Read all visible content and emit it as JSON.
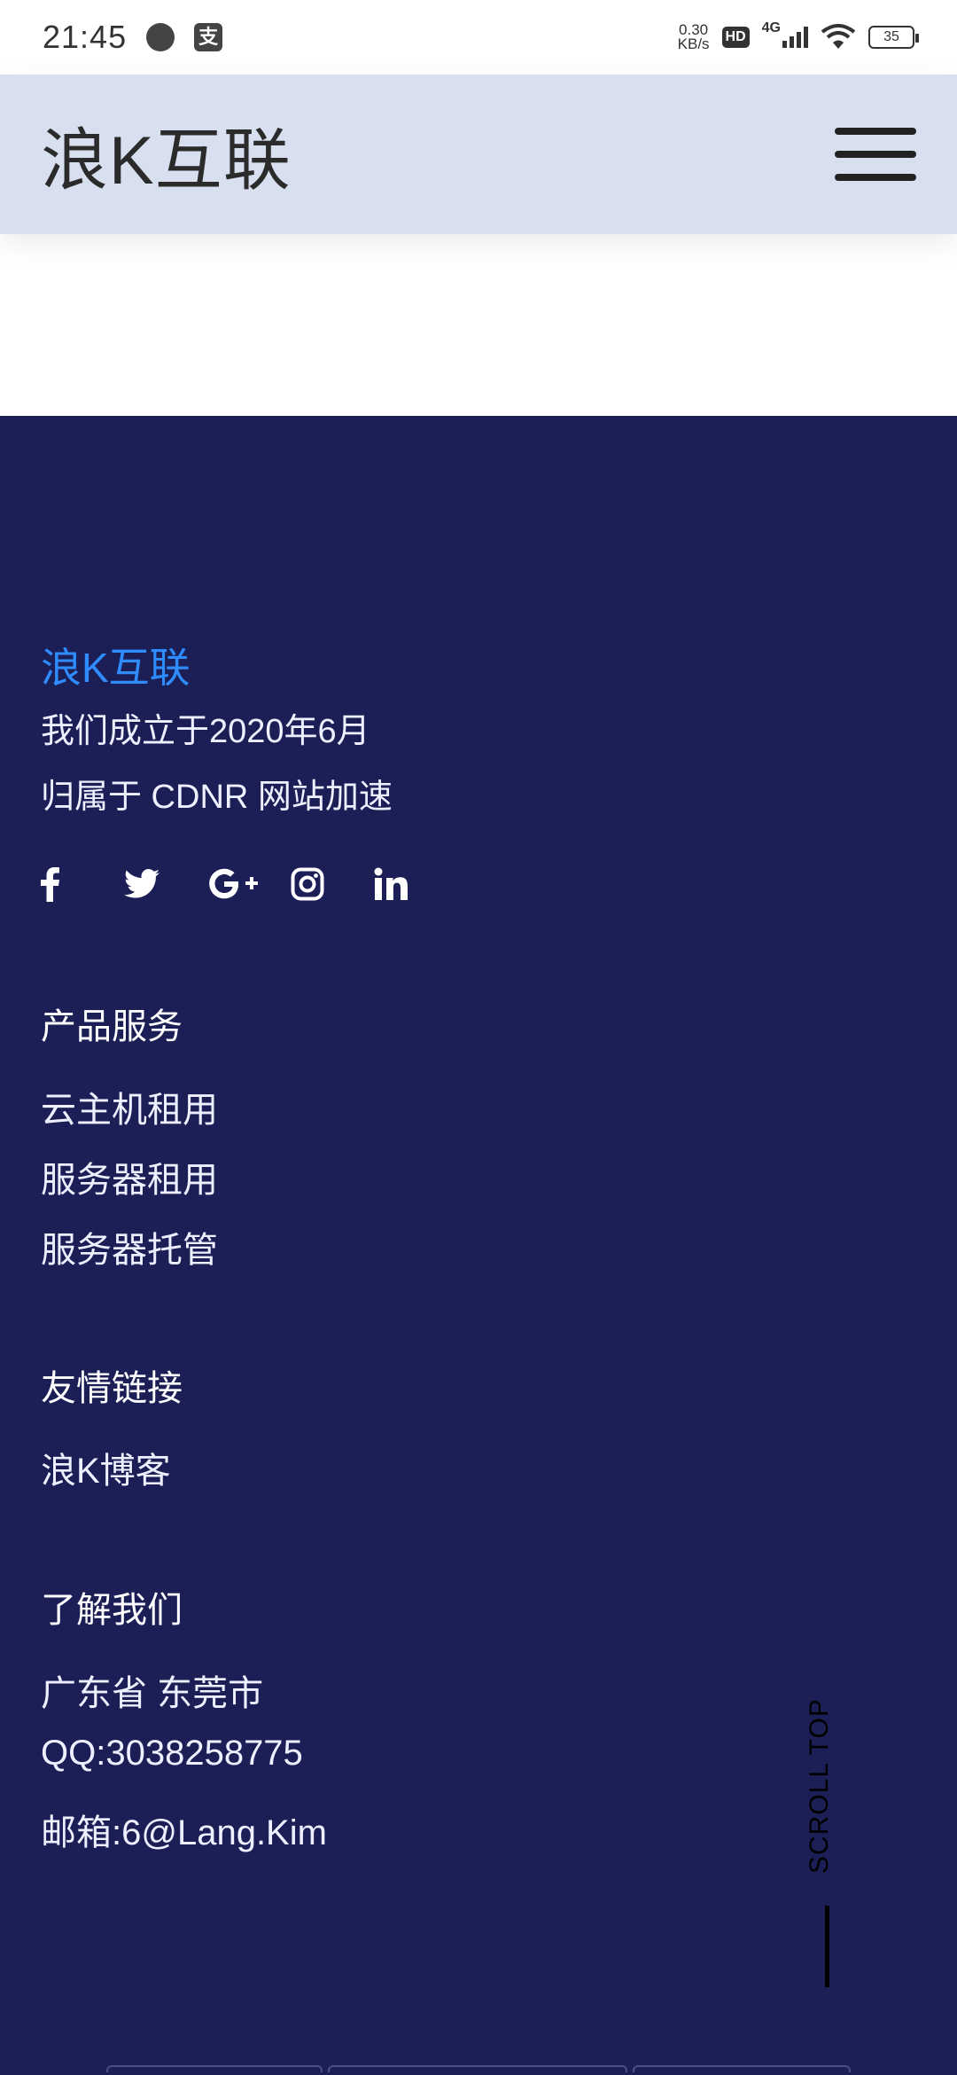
{
  "status_bar": {
    "time": "21:45",
    "pay_glyph": "支",
    "speed_value": "0.30",
    "speed_unit": "KB/s",
    "hd": "HD",
    "network": "4G",
    "battery": "35"
  },
  "navbar": {
    "brand": "浪K互联",
    "menu_icon": "hamburger-menu-icon"
  },
  "footer": {
    "about": {
      "title": "浪K互联",
      "line1": "我们成立于2020年6月",
      "line2": "归属于 CDNR 网站加速"
    },
    "social_icons": [
      "facebook-icon",
      "twitter-icon",
      "google-plus-icon",
      "instagram-icon",
      "linkedin-icon"
    ],
    "products": {
      "heading": "产品服务",
      "links": [
        "云主机租用",
        "服务器租用",
        "服务器托管"
      ]
    },
    "friends": {
      "heading": "友情链接",
      "links": [
        "浪K博客"
      ]
    },
    "contact": {
      "heading": "了解我们",
      "items": [
        "广东省 东莞市",
        "QQ:3038258775",
        "邮箱:6@Lang.Kim"
      ]
    },
    "scroll_top": "SCROLL TOP"
  },
  "colors": {
    "navbar_bg": "#d8dfee",
    "footer_bg": "#1b1f56",
    "accent": "#2f8cff"
  }
}
